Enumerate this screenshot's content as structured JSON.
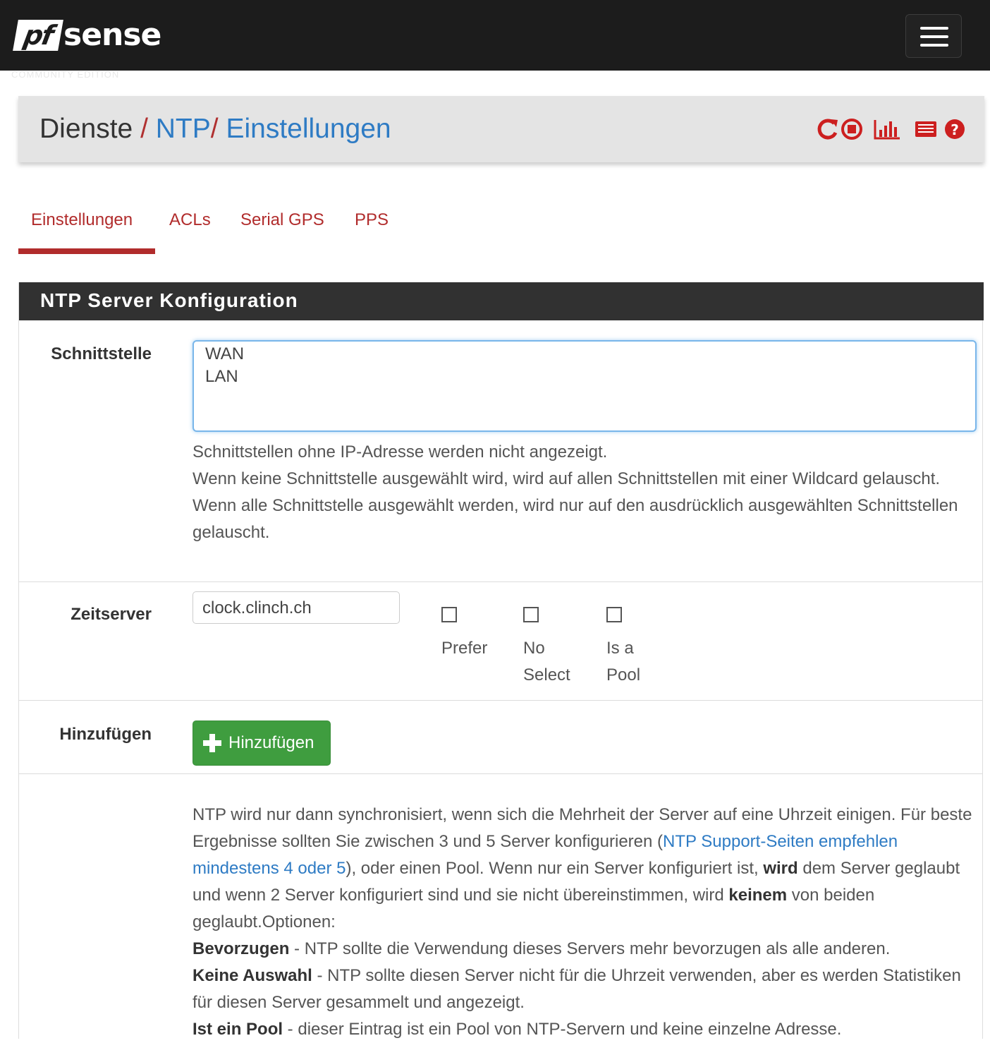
{
  "navbar": {
    "brand_pf": "pf",
    "brand_sense": "sense",
    "edition": "COMMUNITY EDITION"
  },
  "breadcrumb": {
    "part1": "Dienste",
    "sep": "/",
    "part2": "NTP",
    "part3": "Einstellungen",
    "icons": [
      "restart-service-icon",
      "stop-service-icon",
      "graph-icon",
      "log-icon",
      "help-icon"
    ],
    "icon_color": "#cc1f1f"
  },
  "tabs": [
    {
      "label": "Einstellungen",
      "active": true
    },
    {
      "label": "ACLs",
      "active": false
    },
    {
      "label": "Serial GPS",
      "active": false
    },
    {
      "label": "PPS",
      "active": false
    }
  ],
  "panel": {
    "title": "NTP Server Konfiguration",
    "interface": {
      "label": "Schnittstelle",
      "options": [
        "WAN",
        "LAN"
      ],
      "help": [
        "Schnittstellen ohne IP-Adresse werden nicht angezeigt.",
        "Wenn keine Schnittstelle ausgewählt wird, wird auf allen Schnittstellen mit einer Wildcard gelauscht.",
        "Wenn alle Schnittstelle ausgewählt werden, wird nur auf den ausdrücklich ausgewählten Schnittstellen gelauscht."
      ]
    },
    "timeserver": {
      "label": "Zeitserver",
      "value": "clock.clinch.ch",
      "checkboxes": [
        {
          "label": "Prefer",
          "checked": false
        },
        {
          "label": "No Select",
          "checked": false
        },
        {
          "label": "Is a Pool",
          "checked": false
        }
      ]
    },
    "add": {
      "label": "Hinzufügen",
      "button": "Hinzufügen"
    },
    "info": {
      "p1": "NTP wird nur dann synchronisiert, wenn sich die Mehrheit der Server auf eine Uhrzeit einigen. Für beste Ergebnisse sollten Sie zwischen 3 und 5 Server konfigurieren (",
      "link": "NTP Support-Seiten empfehlen mindestens 4 oder 5",
      "p2": "), oder einen Pool. Wenn nur ein Server konfiguriert ist, ",
      "b1": "wird",
      "p3": " dem Server geglaubt und wenn 2 Server konfiguriert sind und sie nicht übereinstimmen, wird ",
      "b2": "keinem",
      "p4": " von beiden geglaubt.Optionen:",
      "opt1_b": "Bevorzugen",
      "opt1": " - NTP sollte die Verwendung dieses Servers mehr bevorzugen als alle anderen.",
      "opt2_b": "Keine Auswahl",
      "opt2": " - NTP sollte diesen Server nicht für die Uhrzeit verwenden, aber es werden Statistiken für diesen Server gesammelt und angezeigt.",
      "opt3_b": "Ist ein Pool",
      "opt3": " - dieser Eintrag ist ein Pool von NTP-Servern und keine einzelne Adresse."
    }
  },
  "colors": {
    "accent_red": "#b12c2c",
    "link_blue": "#2e7bc4",
    "success_green": "#3f9d3f"
  }
}
